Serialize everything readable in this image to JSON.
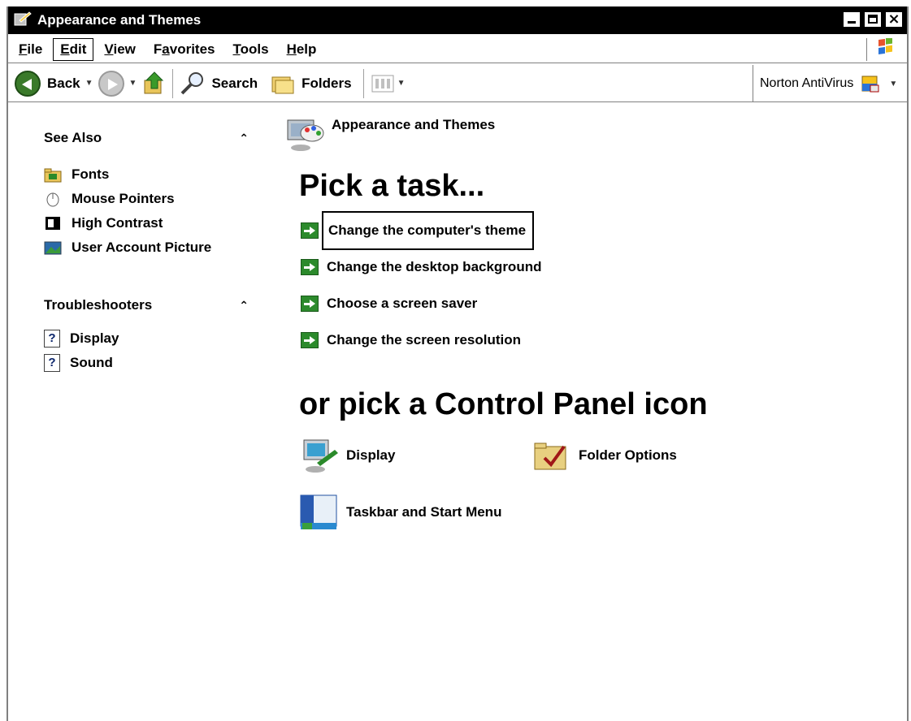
{
  "window": {
    "title": "Appearance and Themes"
  },
  "title_buttons": {
    "minimize": "_",
    "maximize": "□",
    "close": "×"
  },
  "menu": [
    {
      "label": "File",
      "accel": "F",
      "rest": "ile"
    },
    {
      "label": "Edit",
      "accel": "E",
      "rest": "dit"
    },
    {
      "label": "View",
      "accel": "V",
      "rest": "iew"
    },
    {
      "label": "Favorites",
      "pre": "F",
      "accel": "a",
      "rest": "vorites"
    },
    {
      "label": "Tools",
      "accel": "T",
      "rest": "ools"
    },
    {
      "label": "Help",
      "accel": "H",
      "rest": "elp"
    }
  ],
  "toolbar": {
    "back": "Back",
    "search": "Search",
    "folders": "Folders",
    "norton": "Norton AntiVirus"
  },
  "sidebar": {
    "see_also": {
      "heading": "See Also",
      "items": [
        "Fonts",
        "Mouse Pointers",
        "High Contrast",
        "User Account Picture"
      ]
    },
    "troubleshooters": {
      "heading": "Troubleshooters",
      "items": [
        "Display",
        "Sound"
      ]
    }
  },
  "main": {
    "category": "Appearance and Themes",
    "pick_task": "Pick a task...",
    "tasks": [
      "Change the computer's theme",
      "Change the desktop background",
      "Choose a screen saver",
      "Change the screen resolution"
    ],
    "or_pick": "or pick a Control Panel icon",
    "icons": [
      "Display",
      "Folder Options",
      "Taskbar and Start Menu"
    ]
  },
  "colors": {
    "titlebar": "#000000",
    "task_arrow": "#2c8a2c",
    "link_text": "#000000"
  }
}
